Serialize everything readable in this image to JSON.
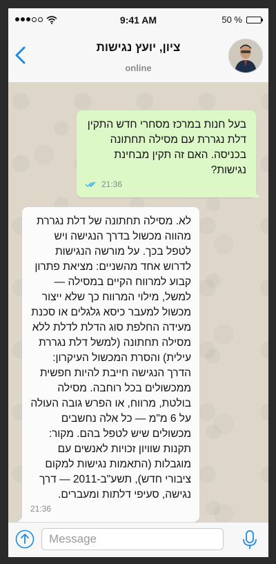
{
  "status_bar": {
    "time": "9:41 AM",
    "battery_percent": "50 %",
    "battery_level": 0.5,
    "icons": [
      "signal-dots-icon",
      "wifi-icon",
      "battery-icon"
    ]
  },
  "header": {
    "title": "ציון, יועץ נגישות",
    "subtitle": "online",
    "icons": [
      "back-chevron-icon",
      "avatar"
    ]
  },
  "messages": [
    {
      "direction": "outgoing",
      "text": "בעל חנות במרכז מסחרי חדש התקין דלת נגררת עם מסילה תחתונה בכניסה. האם זה תקין מבחינת נגישות?",
      "time": "21:36",
      "status_icon": "double-check-icon"
    },
    {
      "direction": "incoming",
      "text": "לא. מסילה תחתונה של דלת נגררת מהווה מכשול בדרך הנגישה ויש לטפל בכך. על מורשה הנגישות לדרוש אחד מהשניים: מציאת פתרון קבוע למרווח הקיים במסילה — למשל, מילוי המרווח כך שלא ייצור מכשול למעבר כיסא גלגלים או סכנת מעידה החלפת סוג הדלת לדלת ללא מסילה תחתונה (למשל דלת נגררת עילית) והסרת המכשול העיקרון: הדרך הנגישה חייבת להיות חפשית ממכשולים בכל רוחבה. מסילה בולטת, מרווח, או הפרש גובה העולה על 6 מ\"מ — כל אלה נחשבים מכשולים שיש לטפל בהם. מקור: תקנות שוויון זכויות לאנשים עם מוגבלות (התאמות נגישות למקום ציבורי חדש), תשע\"ב-2011 — דרך נגישה, סעיפי דלתות ומעברים.",
      "time": "21:36"
    }
  ],
  "composer": {
    "placeholder": "Message",
    "icons": [
      "attach-arrow-up-icon",
      "microphone-icon"
    ]
  },
  "colors": {
    "outgoing_bubble": "#dcf8c6",
    "incoming_bubble": "#fbfbfb",
    "accent": "#1a8be6",
    "read_checks": "#4fb3e8"
  }
}
